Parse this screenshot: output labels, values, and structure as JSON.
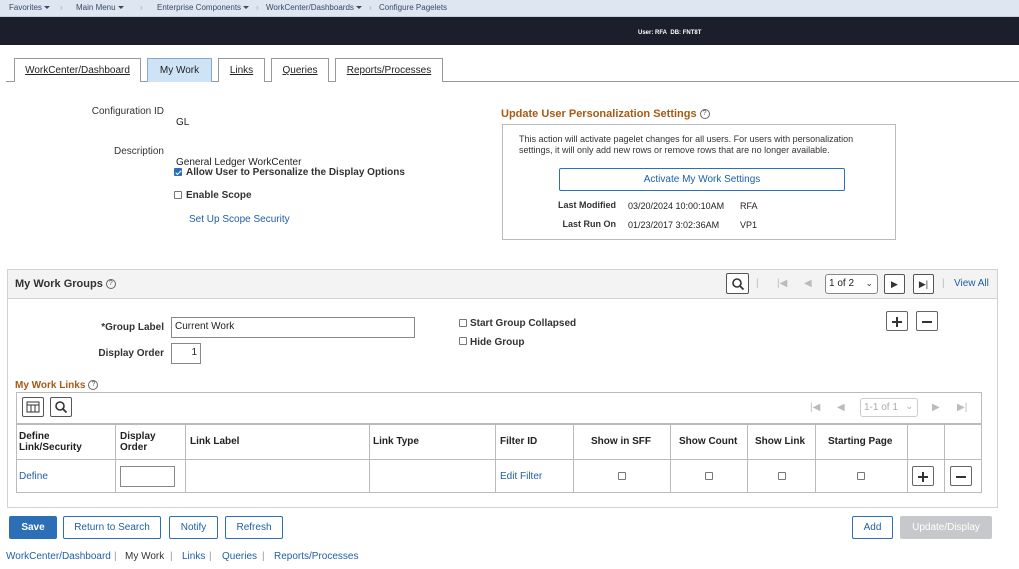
{
  "nav": {
    "favorites": "Favorites",
    "main_menu": "Main Menu",
    "enterprise": "Enterprise Components",
    "workcenter": "WorkCenter/Dashboards",
    "configure": "Configure Pagelets"
  },
  "header": {
    "user": "User: RFA",
    "db": "DB: FNT8T"
  },
  "tabs": [
    "WorkCenter/Dashboard",
    "My Work",
    "Links",
    "Queries",
    "Reports/Processes"
  ],
  "config": {
    "id_label": "Configuration ID",
    "id_value": "GL",
    "desc_label": "Description",
    "desc_value": "General Ledger WorkCenter",
    "allow_personalize": "Allow User to Personalize the Display Options",
    "enable_scope": "Enable Scope",
    "scope_security": "Set Up Scope Security"
  },
  "personalization": {
    "title": "Update User Personalization Settings",
    "description": "This action will activate pagelet changes for all users.  For users with personalization settings, it will only add new rows or remove rows that are no longer available.",
    "activate_button": "Activate My Work Settings",
    "last_modified_label": "Last Modified",
    "last_modified_value": "03/20/2024 10:00:10AM",
    "last_modified_user": "RFA",
    "last_run_label": "Last Run On",
    "last_run_value": "01/23/2017  3:02:36AM",
    "last_run_user": "VP1"
  },
  "groups": {
    "title": "My Work Groups",
    "pager": "1 of 2",
    "view_all": "View All",
    "group_label_label": "*Group Label",
    "group_label_value": "Current Work",
    "display_order_label": "Display Order",
    "display_order_value": "1",
    "start_collapsed": "Start Group Collapsed",
    "hide_group": "Hide Group"
  },
  "links": {
    "title": "My Work Links",
    "pager": "1-1 of 1",
    "columns": [
      "Define Link/Security",
      "Display Order",
      "Link Label",
      "Link Type",
      "Filter ID",
      "Show in SFF",
      "Show Count",
      "Show Link",
      "Starting Page"
    ],
    "row": {
      "define": "Define",
      "filter": "Edit Filter"
    }
  },
  "buttons": {
    "save": "Save",
    "return": "Return to Search",
    "notify": "Notify",
    "refresh": "Refresh",
    "add": "Add",
    "update": "Update/Display"
  },
  "footer_links": [
    "WorkCenter/Dashboard",
    "My Work",
    "Links",
    "Queries",
    "Reports/Processes"
  ]
}
